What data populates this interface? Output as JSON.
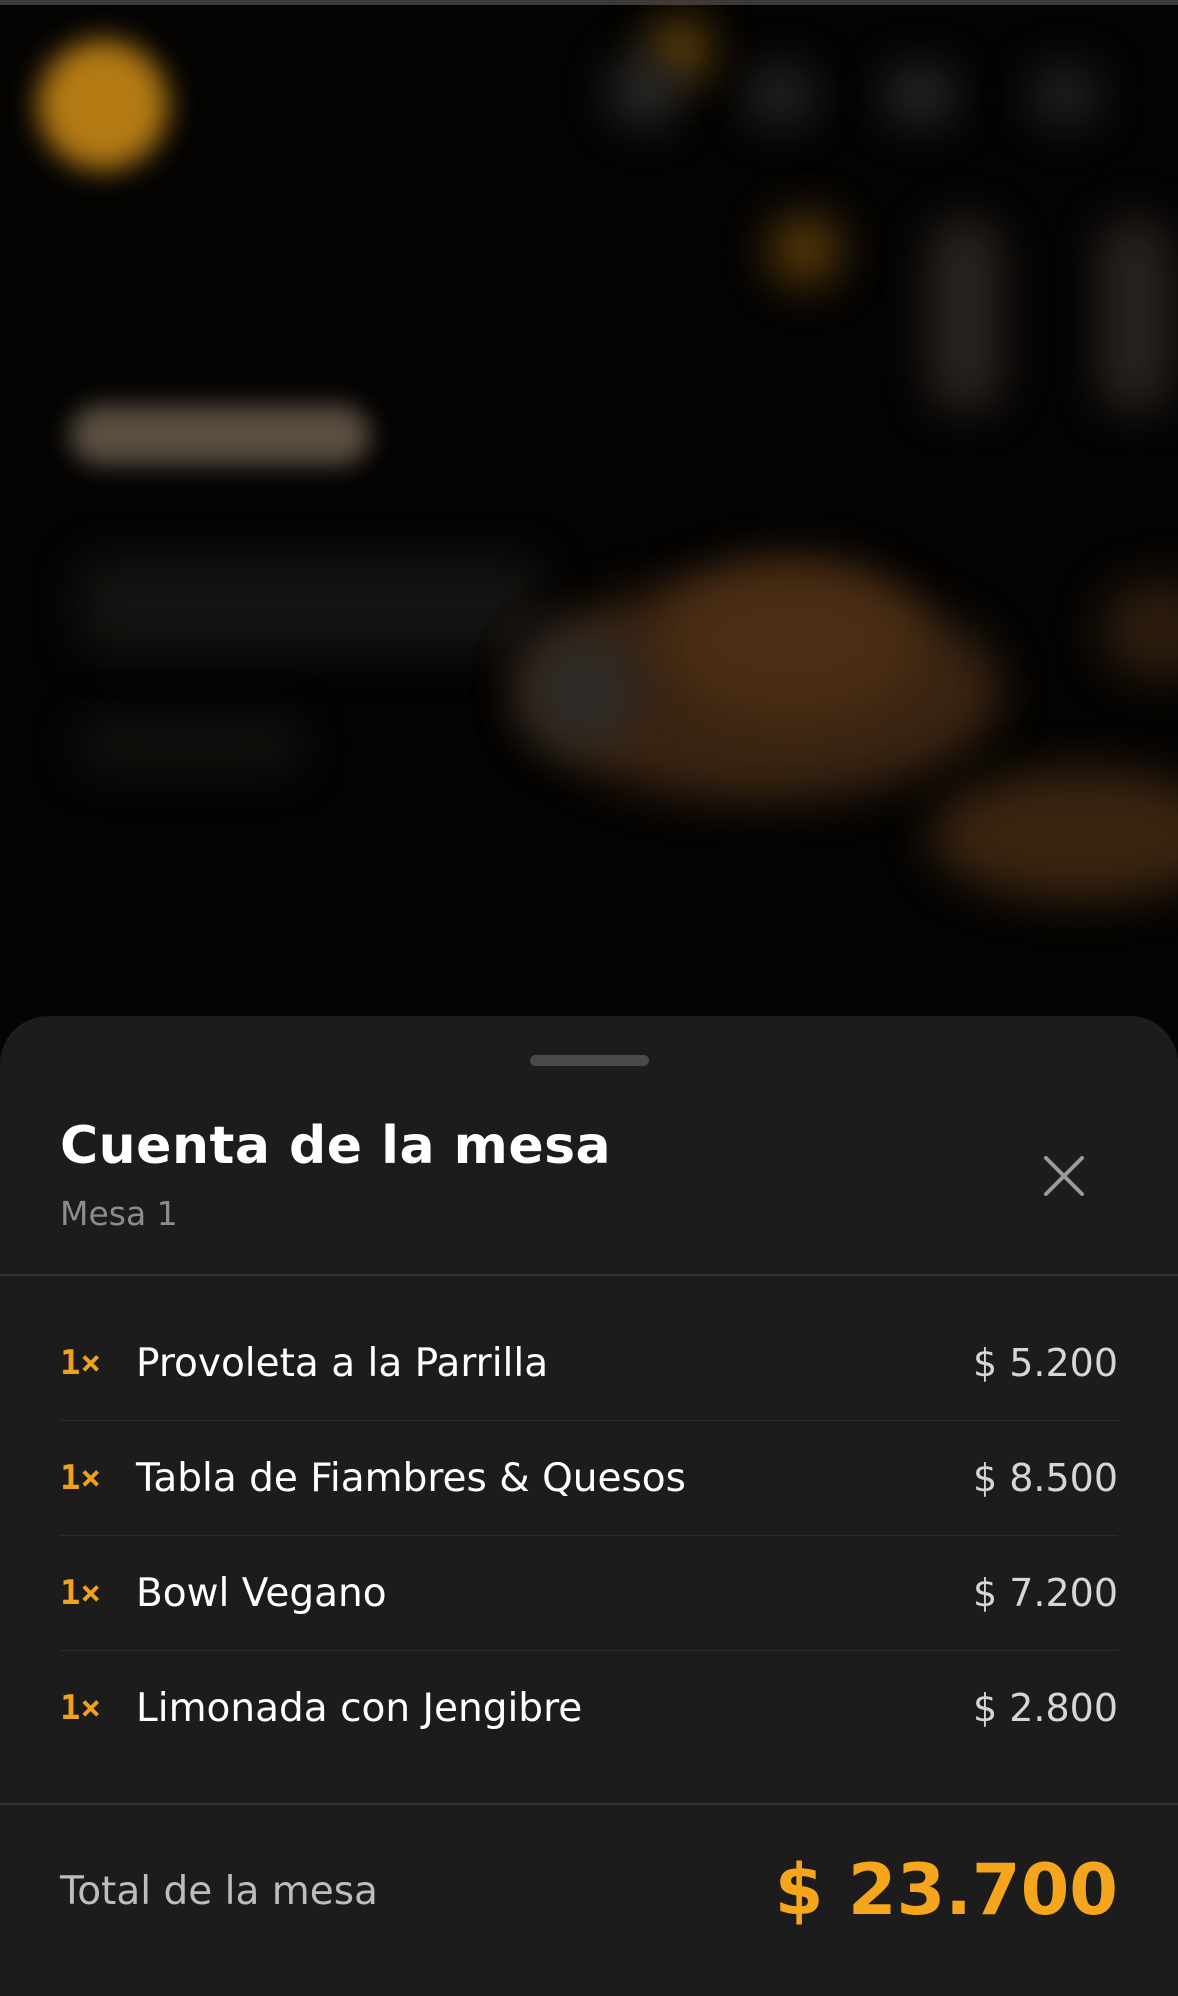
{
  "colors": {
    "accent": "#f5a61d",
    "sheet_background": "#1c1c1c",
    "text_primary": "#ffffff",
    "text_secondary": "#8c8c8c"
  },
  "sheet": {
    "title": "Cuenta de la mesa",
    "subtitle": "Mesa 1",
    "close_icon": "close-icon"
  },
  "items": [
    {
      "qty": "1×",
      "name": "Provoleta a la Parrilla",
      "price": "$ 5.200"
    },
    {
      "qty": "1×",
      "name": "Tabla de Fiambres & Quesos",
      "price": "$ 8.500"
    },
    {
      "qty": "1×",
      "name": "Bowl Vegano",
      "price": "$ 7.200"
    },
    {
      "qty": "1×",
      "name": "Limonada con Jengibre",
      "price": "$ 2.800"
    }
  ],
  "total": {
    "label": "Total de la mesa",
    "value": "$ 23.700"
  }
}
